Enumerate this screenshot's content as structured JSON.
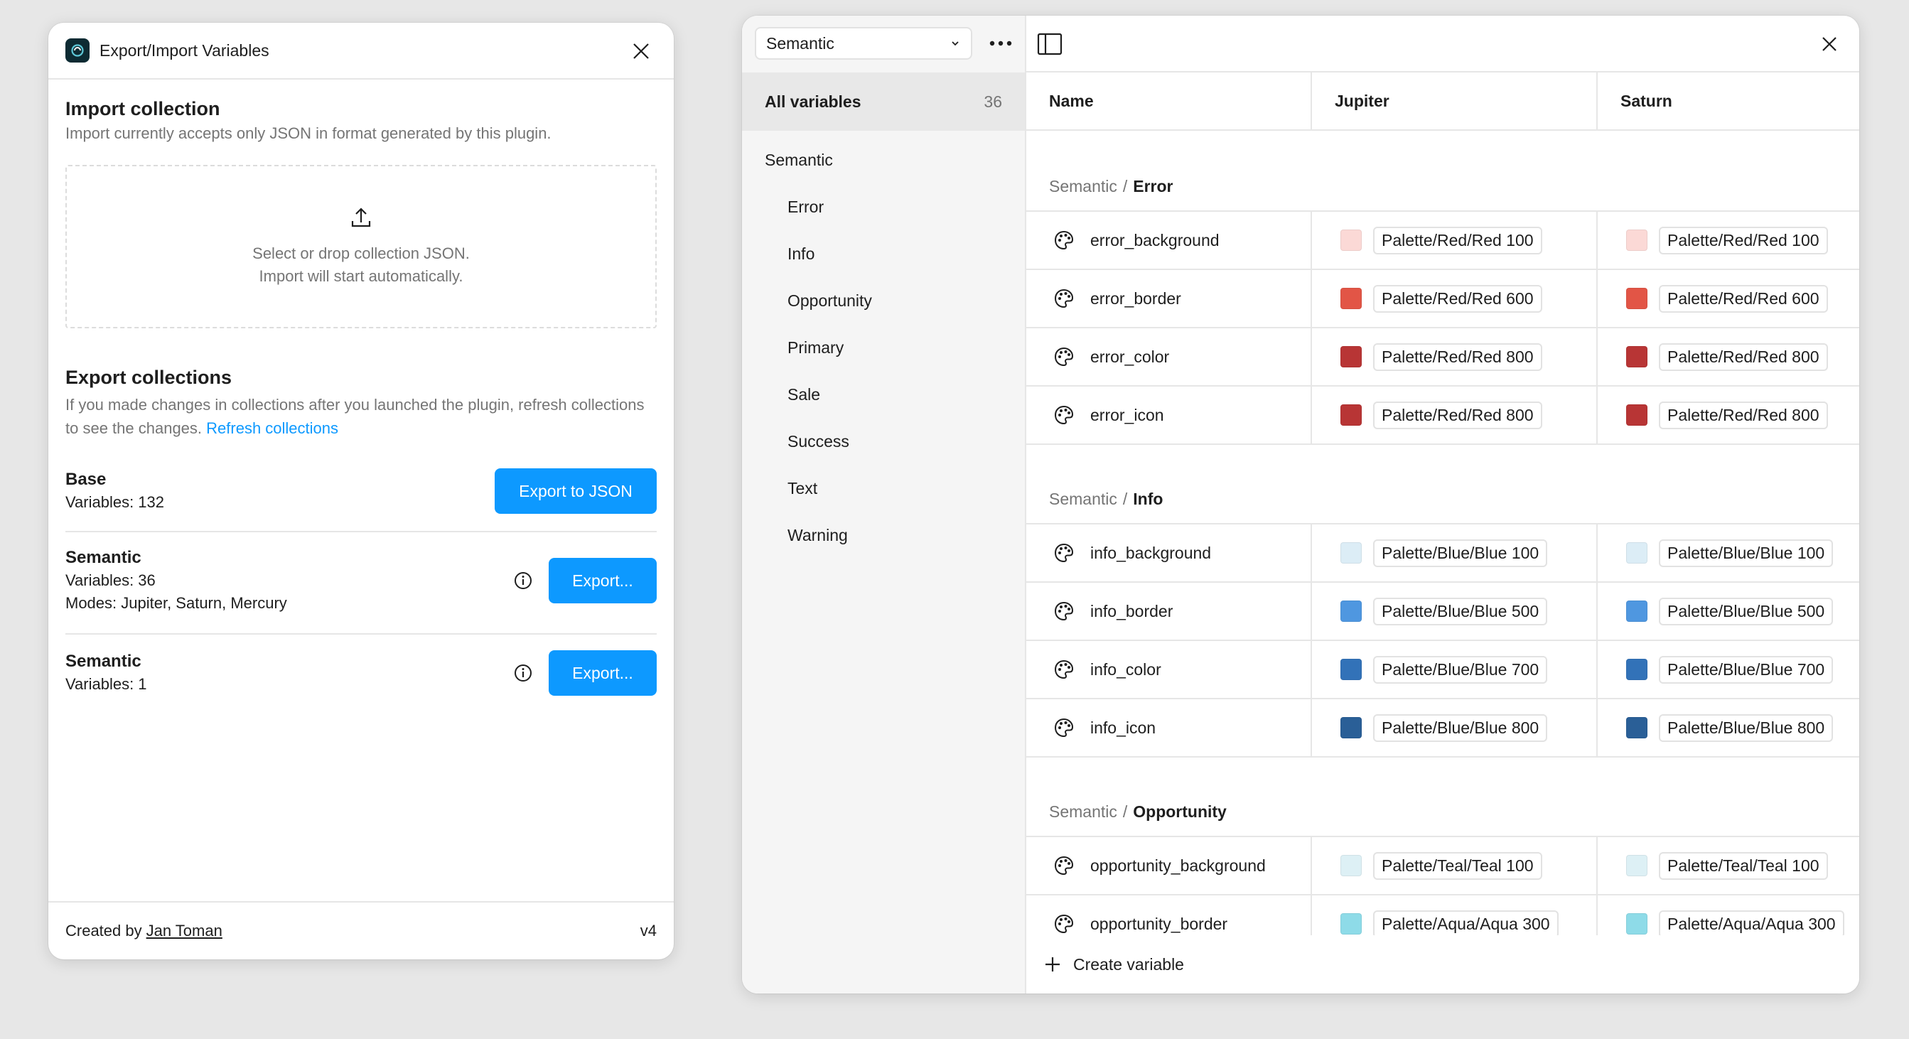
{
  "plugin": {
    "title": "Export/Import Variables",
    "import": {
      "title": "Import collection",
      "desc": "Import currently accepts only JSON in format generated by this plugin.",
      "drop_line1": "Select or drop collection JSON.",
      "drop_line2": "Import will start automatically."
    },
    "export": {
      "title": "Export collections",
      "desc": "If you made changes in collections after you launched the plugin, refresh collections to see the changes.",
      "refresh_label": "Refresh collections",
      "collections": [
        {
          "name": "Base",
          "variables": "Variables: 132",
          "button": "Export to JSON"
        },
        {
          "name": "Semantic",
          "variables": "Variables: 36",
          "modes": "Modes: Jupiter, Saturn, Mercury",
          "button": "Export..."
        },
        {
          "name": "Semantic",
          "variables": "Variables: 1",
          "button": "Export..."
        }
      ]
    },
    "footer": {
      "created_by": "Created by",
      "author": "Jan Toman",
      "version": "v4"
    }
  },
  "variables_window": {
    "collection_select": "Semantic",
    "sidebar": {
      "all_label": "All variables",
      "all_count": "36",
      "group": "Semantic",
      "items": [
        "Error",
        "Info",
        "Opportunity",
        "Primary",
        "Sale",
        "Success",
        "Text",
        "Warning"
      ]
    },
    "columns": {
      "name": "Name",
      "mode1": "Jupiter",
      "mode2": "Saturn"
    },
    "groups": [
      {
        "prefix": "Semantic",
        "name": "Error",
        "rows": [
          {
            "name": "error_background",
            "m1": "Palette/Red/Red 100",
            "m2": "Palette/Red/Red 100",
            "c1": "#fbd9d6",
            "c2": "#fbd9d6"
          },
          {
            "name": "error_border",
            "m1": "Palette/Red/Red 600",
            "m2": "Palette/Red/Red 600",
            "c1": "#e25546",
            "c2": "#e25546"
          },
          {
            "name": "error_color",
            "m1": "Palette/Red/Red 800",
            "m2": "Palette/Red/Red 800",
            "c1": "#b83535",
            "c2": "#b83535"
          },
          {
            "name": "error_icon",
            "m1": "Palette/Red/Red 800",
            "m2": "Palette/Red/Red 800",
            "c1": "#b83535",
            "c2": "#b83535"
          }
        ]
      },
      {
        "prefix": "Semantic",
        "name": "Info",
        "rows": [
          {
            "name": "info_background",
            "m1": "Palette/Blue/Blue 100",
            "m2": "Palette/Blue/Blue 100",
            "c1": "#dcedf6",
            "c2": "#dcedf6"
          },
          {
            "name": "info_border",
            "m1": "Palette/Blue/Blue 500",
            "m2": "Palette/Blue/Blue 500",
            "c1": "#4f97e0",
            "c2": "#4f97e0"
          },
          {
            "name": "info_color",
            "m1": "Palette/Blue/Blue 700",
            "m2": "Palette/Blue/Blue 700",
            "c1": "#3272b8",
            "c2": "#3272b8"
          },
          {
            "name": "info_icon",
            "m1": "Palette/Blue/Blue 800",
            "m2": "Palette/Blue/Blue 800",
            "c1": "#2a5f97",
            "c2": "#2a5f97"
          }
        ]
      },
      {
        "prefix": "Semantic",
        "name": "Opportunity",
        "rows": [
          {
            "name": "opportunity_background",
            "m1": "Palette/Teal/Teal 100",
            "m2": "Palette/Teal/Teal 100",
            "c1": "#ddf0f5",
            "c2": "#ddf0f5"
          },
          {
            "name": "opportunity_border",
            "m1": "Palette/Aqua/Aqua 300",
            "m2": "Palette/Aqua/Aqua 300",
            "c1": "#8edbe8",
            "c2": "#8edbe8"
          }
        ]
      }
    ],
    "create_label": "Create variable"
  },
  "colors": {
    "accent": "#0d99ff",
    "background": "#e7e7e7"
  }
}
